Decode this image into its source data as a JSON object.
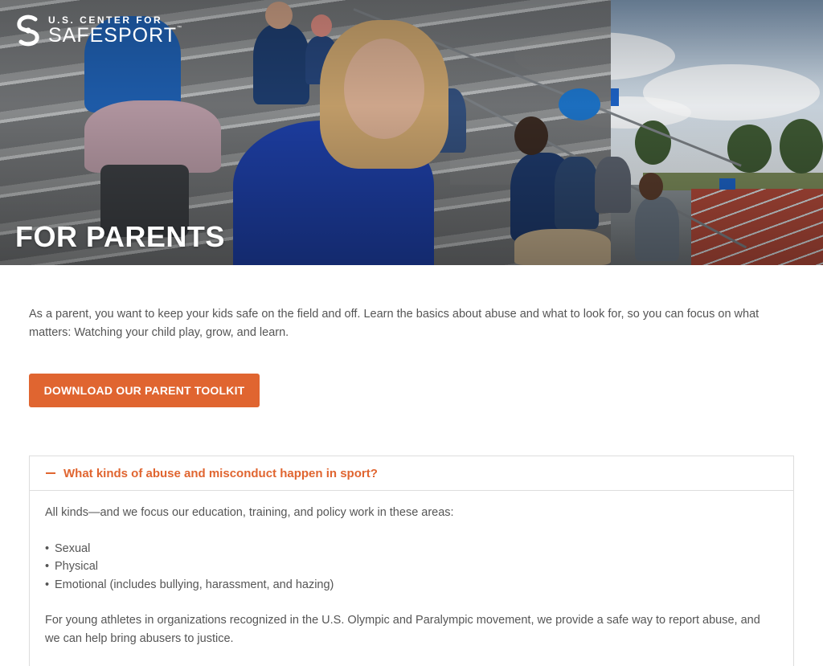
{
  "brand": {
    "top": "U.S. CENTER FOR",
    "name": "SAFESPORT",
    "tm": "™"
  },
  "hero": {
    "title": "FOR PARENTS"
  },
  "intro": {
    "text": "As a parent, you want to keep your kids safe on the field and off. Learn the basics about abuse and what to look for, so you can focus on what matters: Watching your child play, grow, and learn."
  },
  "cta": {
    "label": "DOWNLOAD OUR PARENT TOOLKIT"
  },
  "accordion": {
    "title": "What kinds of abuse and misconduct happen in sport?",
    "lead": "All kinds—and we focus our education, training, and policy work in these areas:",
    "items": [
      "Sexual",
      "Physical",
      "Emotional (includes bullying, harassment, and hazing)"
    ],
    "bullet": "•",
    "closing": "For young athletes in organizations recognized in the U.S. Olympic and Paralympic movement, we provide a safe way to report abuse, and we can help bring abusers to justice."
  },
  "colors": {
    "accent": "#e06530",
    "text": "#555555",
    "border": "#dddddd"
  }
}
